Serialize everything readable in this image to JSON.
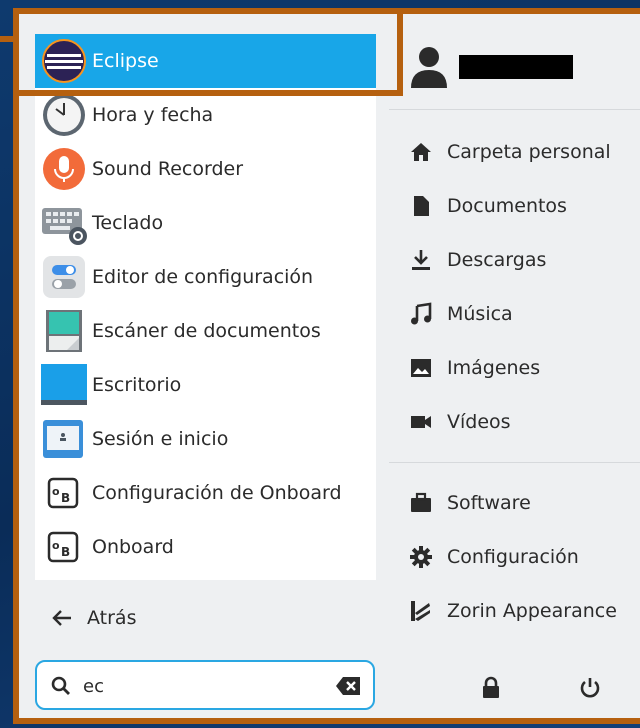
{
  "apps": [
    {
      "label": "Eclipse",
      "icon": "eclipse-icon",
      "selected": true
    },
    {
      "label": "Hora y fecha",
      "icon": "clock-icon"
    },
    {
      "label": "Sound Recorder",
      "icon": "microphone-icon"
    },
    {
      "label": "Teclado",
      "icon": "keyboard-icon"
    },
    {
      "label": "Editor de configuración",
      "icon": "toggle-settings-icon"
    },
    {
      "label": "Escáner de documentos",
      "icon": "scanner-icon"
    },
    {
      "label": "Escritorio",
      "icon": "desktop-icon"
    },
    {
      "label": "Sesión e inicio",
      "icon": "session-icon"
    },
    {
      "label": "Configuración de Onboard",
      "icon": "onboard-icon"
    },
    {
      "label": "Onboard",
      "icon": "onboard-icon"
    }
  ],
  "back": {
    "label": "Atrás"
  },
  "search": {
    "value": "ec"
  },
  "places": [
    {
      "label": "Carpeta personal",
      "icon": "home-icon"
    },
    {
      "label": "Documentos",
      "icon": "document-icon"
    },
    {
      "label": "Descargas",
      "icon": "download-icon"
    },
    {
      "label": "Música",
      "icon": "music-icon"
    },
    {
      "label": "Imágenes",
      "icon": "image-icon"
    },
    {
      "label": "Vídeos",
      "icon": "video-icon"
    }
  ],
  "system": [
    {
      "label": "Software",
      "icon": "briefcase-icon"
    },
    {
      "label": "Configuración",
      "icon": "gear-icon"
    },
    {
      "label": "Zorin Appearance",
      "icon": "zorin-appearance-icon"
    }
  ],
  "colors": {
    "accent": "#18a6e8",
    "highlight": "#b5600f",
    "panel": "#eef0f2",
    "text": "#2b2b2b"
  }
}
